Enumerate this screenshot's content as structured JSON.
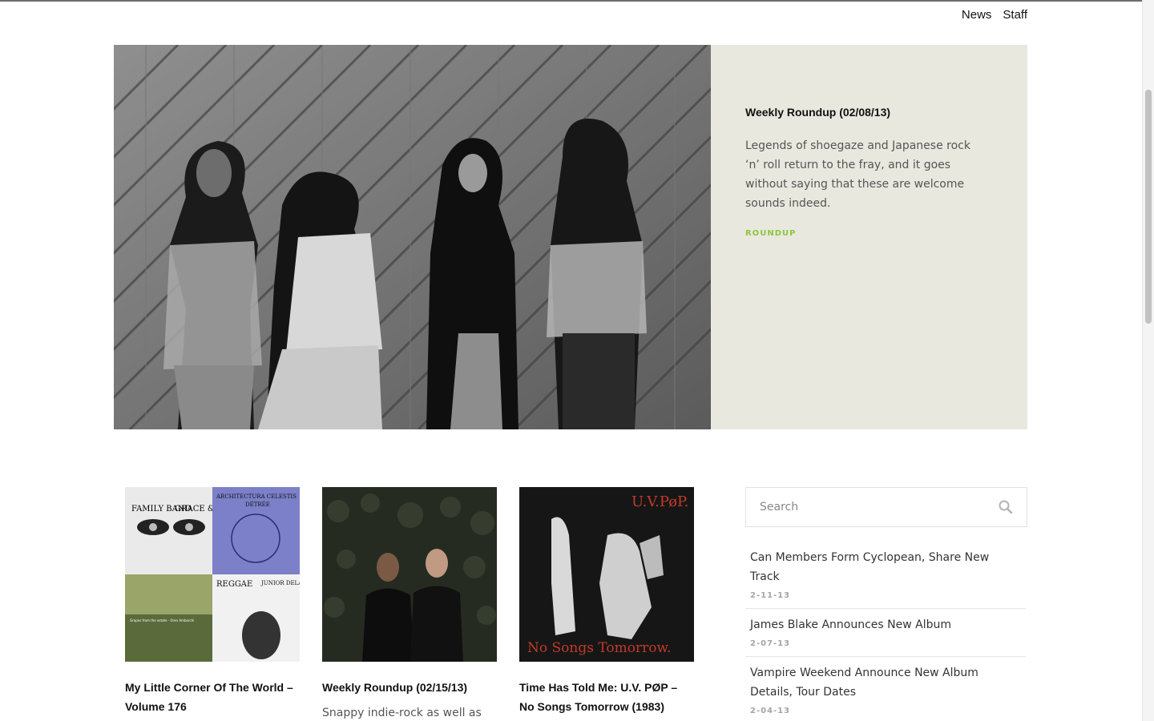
{
  "nav": {
    "items": [
      {
        "label": "News"
      },
      {
        "label": "Staff"
      }
    ]
  },
  "hero": {
    "title": "Weekly Roundup (02/08/13)",
    "excerpt": "Legends of shoegaze and Japanese rock ‘n’ roll return to the fray, and it goes without saying that these are welcome sounds indeed.",
    "tag": "ROUNDUP",
    "panel_color": "#e9e8df",
    "tag_color": "#8cc63f"
  },
  "cards": [
    {
      "title": "My Little Corner Of The World – Volume 176",
      "excerpt": "",
      "cover_text": [
        "FAMILY BAND",
        "GRACE & LIES",
        "ARCHITECTURA CELESTIS",
        "DÉTRÉE",
        "REGGAE",
        "JUNIOR DELAHAYE",
        "Grapes from the estate · Oren Ambarchi"
      ]
    },
    {
      "title": "Weekly Roundup (02/15/13)",
      "excerpt": "Snappy indie-rock as well as"
    },
    {
      "title": "Time Has Told Me: U.V. PØP – No Songs Tomorrow (1983)",
      "excerpt": "",
      "cover_text": [
        "U.V.PøP.",
        "No Songs Tomorrow."
      ]
    }
  ],
  "sidebar": {
    "search": {
      "placeholder": "Search",
      "value": ""
    },
    "news": [
      {
        "title": "Can Members Form Cyclopean, Share New Track",
        "date": "2-11-13"
      },
      {
        "title": "James Blake Announces New Album",
        "date": "2-07-13"
      },
      {
        "title": "Vampire Weekend Announce New Album Details, Tour Dates",
        "date": "2-04-13"
      }
    ]
  },
  "icons": {
    "search": "search-icon"
  }
}
